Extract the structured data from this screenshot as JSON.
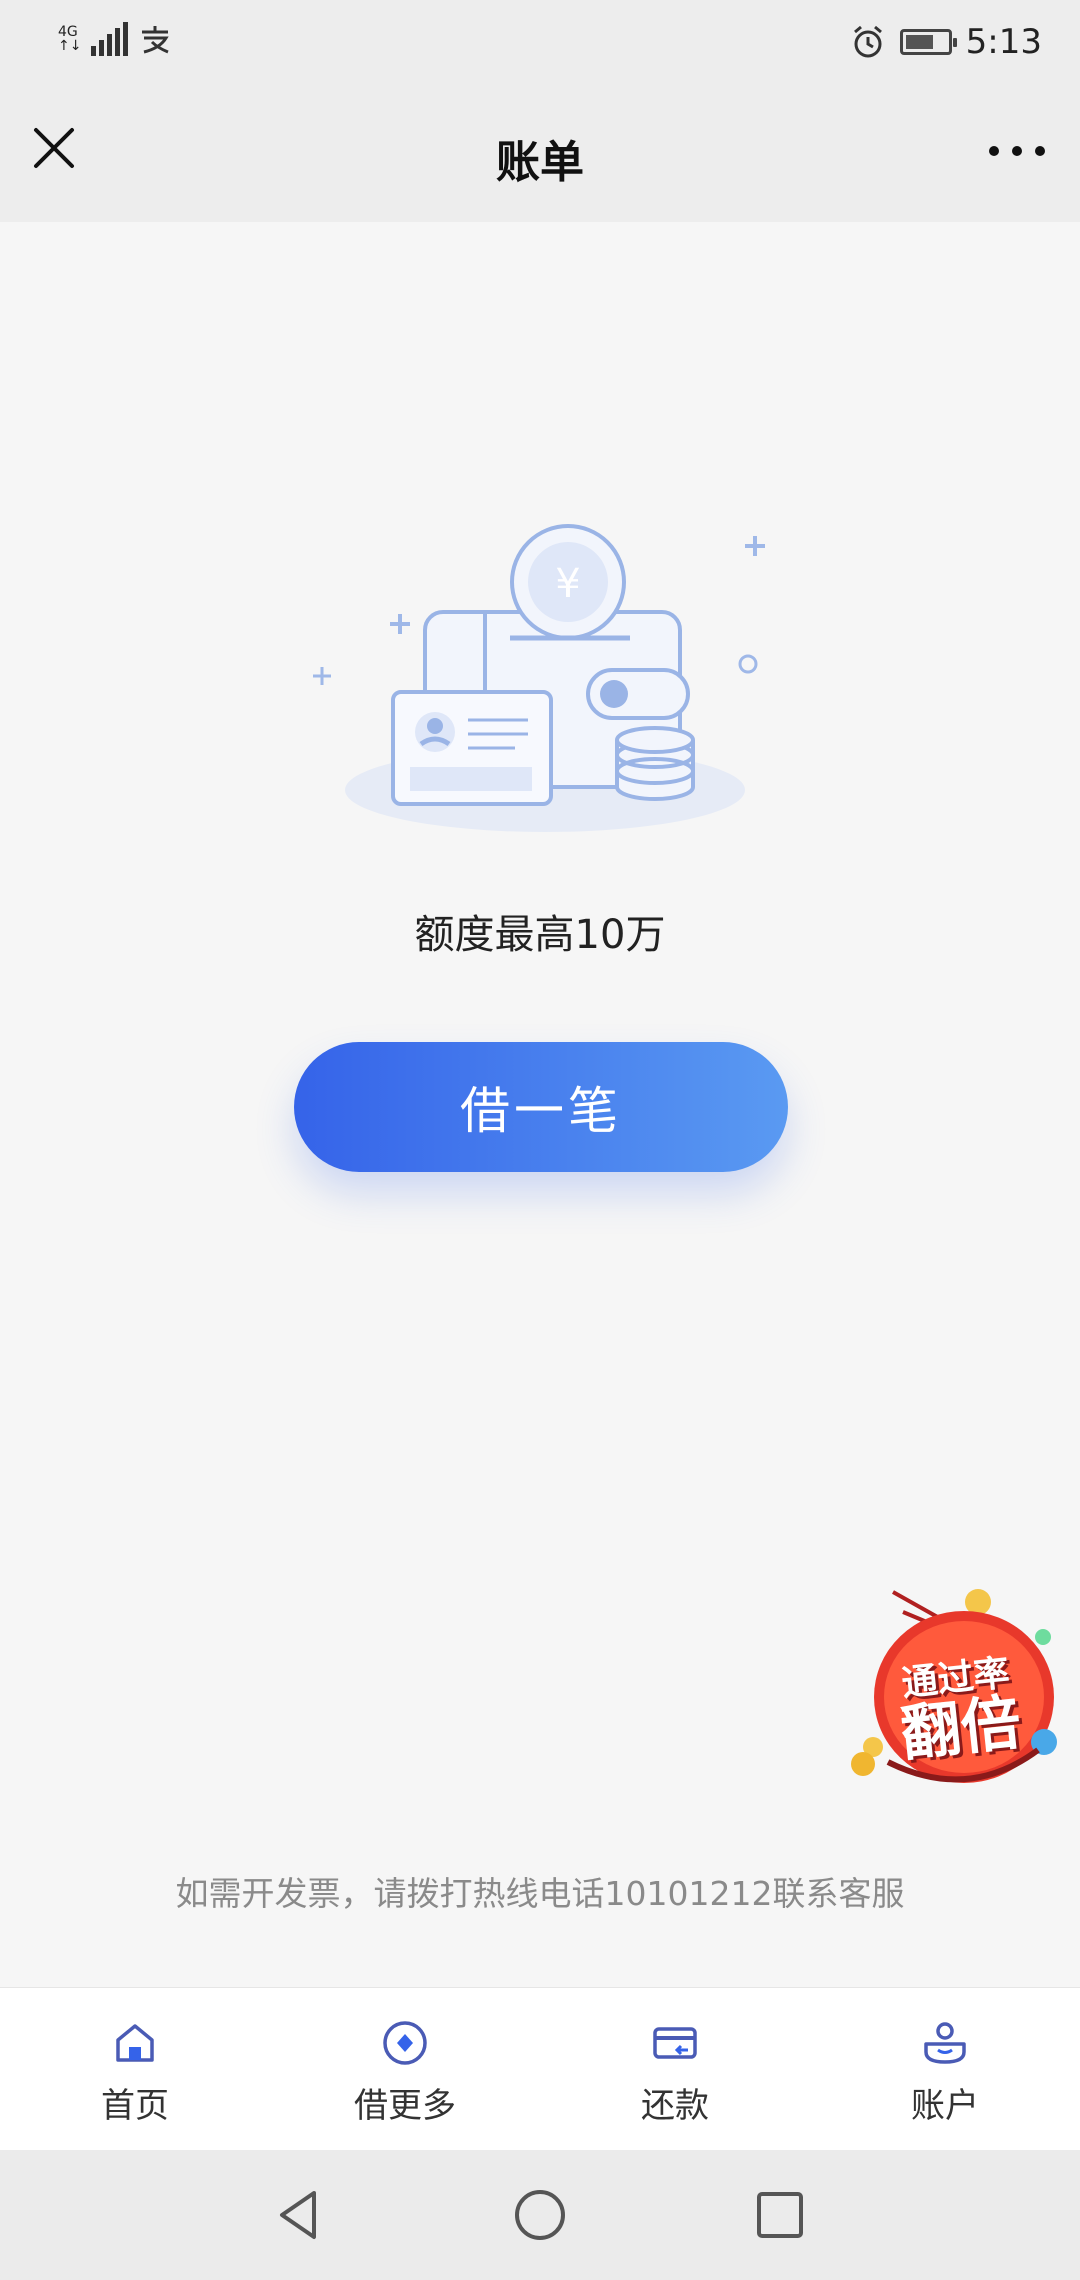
{
  "status_bar": {
    "network": "4G",
    "network_sub": "↑↓",
    "notify_icon": "alipay-icon",
    "time": "5:13"
  },
  "title_bar": {
    "title": "账单",
    "close_icon": "close-icon",
    "more_icon": "more-icon"
  },
  "main": {
    "quota_text": "额度最高10万",
    "borrow_button": "借一笔",
    "promo_line1": "通过率",
    "promo_line2": "翻倍",
    "invoice_note": "如需开发票，请拨打热线电话10101212联系客服"
  },
  "bottom_nav": {
    "items": [
      {
        "label": "首页",
        "icon": "home-icon"
      },
      {
        "label": "借更多",
        "icon": "borrow-more-icon"
      },
      {
        "label": "还款",
        "icon": "card-repay-icon"
      },
      {
        "label": "账户",
        "icon": "account-icon"
      }
    ]
  },
  "colors": {
    "primary": "#3563e9",
    "primary_light": "#5a9af2",
    "nav_icon": "#4a5bb5",
    "promo_red": "#e8382b"
  }
}
